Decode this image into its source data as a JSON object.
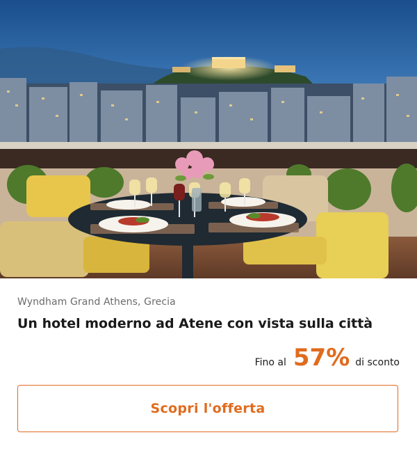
{
  "offer": {
    "hotel_name": "Wyndham Grand Athens, Grecia",
    "title": "Un hotel moderno ad Atene con vista sulla città",
    "discount_prefix": "Fino al",
    "discount_value": "57%",
    "discount_suffix": "di sconto",
    "cta_label": "Scopri l'offerta"
  },
  "colors": {
    "accent": "#e06b1e",
    "title_text": "#1a1a1a",
    "subtitle_text": "#6b6b6b"
  }
}
